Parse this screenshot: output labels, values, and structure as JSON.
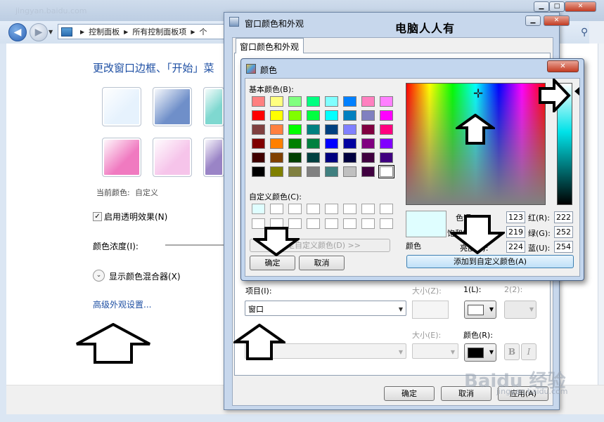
{
  "background_window": {
    "title_ghost": "jingyan.baidu.com",
    "breadcrumb": [
      "控制面板",
      "所有控制面板项",
      "个"
    ],
    "heading": "更改窗口边框、「开始」菜",
    "current_color_label": "当前颜色:",
    "current_color_value": "自定义",
    "transparency_label": "启用透明效果(N)",
    "transparency_checked": "✓",
    "intensity_label": "颜色浓度(I):",
    "mixer_label": "显示颜色混合器(X)",
    "advanced_link": "高级外观设置...",
    "swatches": [
      "#e6f2fd",
      "#6f8fc9",
      "#7fd8d0",
      "#f07ac0",
      "#f6c4ea",
      "#9a84c6"
    ]
  },
  "window_color_dialog": {
    "title": "窗口颜色和外观",
    "watermark_text": "电脑人人有",
    "tab": "窗口颜色和外观",
    "item_label": "项目(I):",
    "item_value": "窗口",
    "size_label": "大小(Z):",
    "color1_label": "1(L):",
    "color2_label": "2(2):",
    "font_size_label": "大小(E):",
    "font_color_label": "颜色(R):",
    "bold": "B",
    "italic": "I",
    "ok": "确定",
    "cancel": "取消",
    "apply": "应用(A)"
  },
  "color_dialog": {
    "title": "颜色",
    "basic_colors_label": "基本颜色(B):",
    "custom_colors_label": "自定义颜色(C):",
    "define_custom_button": "规定自定义颜色(D) >>",
    "ok": "确定",
    "cancel": "取消",
    "color_solid_label": "颜色",
    "hue_label": "色调(E):",
    "sat_label": "饱和度(S):",
    "lum_label": "亮度(L):",
    "red_label": "红(R):",
    "green_label": "绿(G):",
    "blue_label": "蓝(U):",
    "hue": "123",
    "sat": "219",
    "lum": "224",
    "red": "222",
    "green": "252",
    "blue": "254",
    "add_custom_button": "添加到自定义颜色(A)",
    "preview_color": "#dffeff",
    "basic_colors": [
      "#ff8080",
      "#ffff80",
      "#80ff80",
      "#00ff80",
      "#80ffff",
      "#0080ff",
      "#ff80c0",
      "#ff80ff",
      "#ff0000",
      "#ffff00",
      "#80ff00",
      "#00ff40",
      "#00ffff",
      "#0080c0",
      "#8080c0",
      "#ff00ff",
      "#804040",
      "#ff8040",
      "#00ff00",
      "#008080",
      "#004080",
      "#8080ff",
      "#800040",
      "#ff0080",
      "#800000",
      "#ff8000",
      "#008000",
      "#008040",
      "#0000ff",
      "#0000a0",
      "#800080",
      "#8000ff",
      "#400000",
      "#804000",
      "#004000",
      "#004040",
      "#000080",
      "#000040",
      "#400040",
      "#400080",
      "#000000",
      "#808000",
      "#808040",
      "#808080",
      "#408080",
      "#c0c0c0",
      "#400040",
      "#ffffff"
    ],
    "custom_colors": [
      "#dffeff",
      "#ffffff",
      "#ffffff",
      "#ffffff",
      "#ffffff",
      "#ffffff",
      "#ffffff",
      "#ffffff",
      "#ffffff",
      "#ffffff",
      "#ffffff",
      "#ffffff",
      "#ffffff",
      "#ffffff",
      "#ffffff",
      "#ffffff"
    ]
  },
  "watermark": {
    "brand": "Baidu 经验",
    "url": "jingyan.baidu.com"
  }
}
